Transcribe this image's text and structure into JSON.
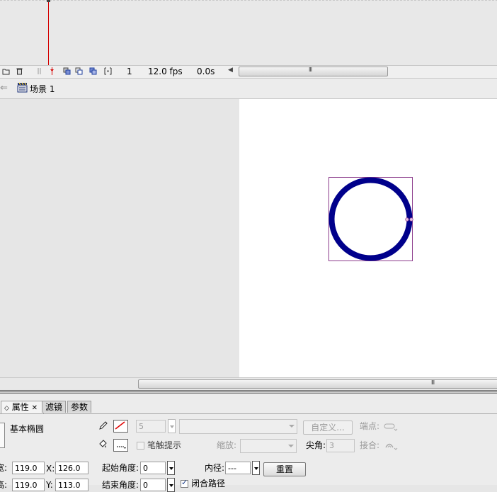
{
  "timeline": {
    "current_frame": "1",
    "frame_rate": "12.0 fps",
    "elapsed_time": "0.0s"
  },
  "edit_bar": {
    "scene_label": "场景 1"
  },
  "stage": {
    "shape": "circle-ring",
    "stroke_color": "#00008B",
    "selection_color": "#8B3A8B"
  },
  "panel": {
    "tabs": [
      {
        "label": "属性"
      },
      {
        "label": "滤镜"
      },
      {
        "label": "参数"
      }
    ],
    "close_glyph": "✕",
    "collapse_glyph": "◇",
    "tool_name": "基本椭圆",
    "stroke_height": "5",
    "custom_button": "自定义...",
    "cap_label": "端点:",
    "join_label": "接合:",
    "stroke_hint_label": "笔触提示",
    "scale_label": "缩放:",
    "miter_label": "尖角:",
    "miter_value": "3",
    "width_label": "宽:",
    "width_value": "119.0",
    "x_label": "X:",
    "x_value": "126.0",
    "height_label": "高:",
    "height_value": "119.0",
    "y_label": "Y:",
    "y_value": "113.0",
    "start_angle_label": "起始角度:",
    "start_angle_value": "0",
    "end_angle_label": "结束角度:",
    "end_angle_value": "0",
    "inner_radius_label": "内径:",
    "inner_radius_value": "---",
    "reset_button": "重置",
    "close_path_label": "闭合路径"
  }
}
